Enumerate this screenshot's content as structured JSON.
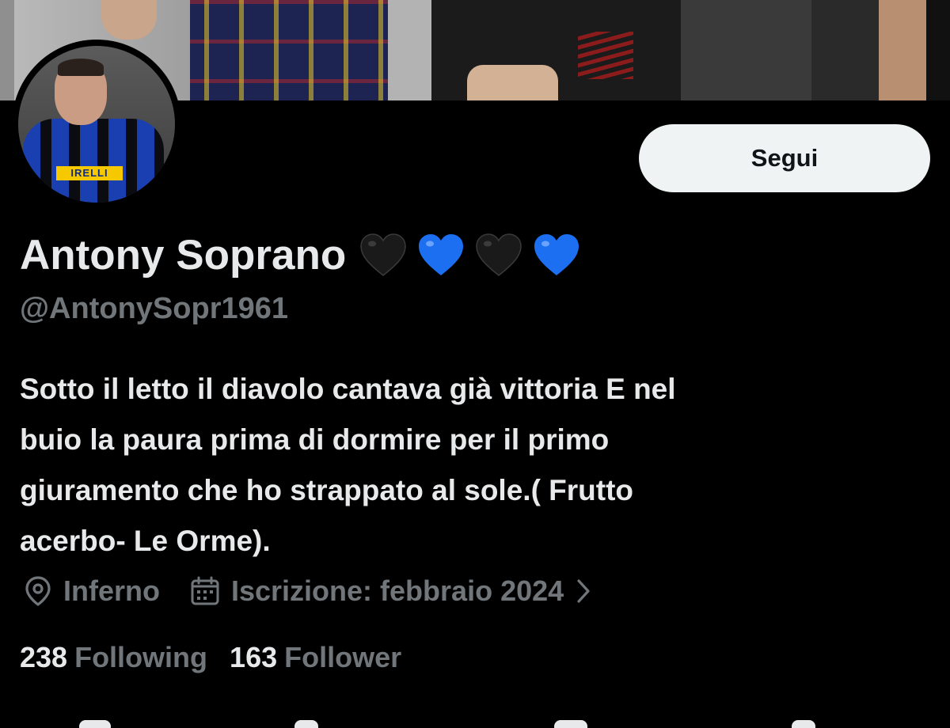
{
  "profile": {
    "display_name": "Antony Soprano",
    "name_emojis": [
      {
        "icon": "black-heart-icon",
        "color": "#1a1a1a"
      },
      {
        "icon": "blue-heart-icon",
        "color": "#1d6ff2"
      },
      {
        "icon": "black-heart-icon",
        "color": "#1a1a1a"
      },
      {
        "icon": "blue-heart-icon",
        "color": "#1d6ff2"
      }
    ],
    "handle": "@AntonySopr1961",
    "bio_lines": [
      "Sotto il letto il diavolo cantava già vittoria E nel",
      "buio la paura prima di dormire per il primo",
      "giuramento che ho strappato al sole.( Frutto",
      "acerbo- Le Orme)."
    ],
    "location": "Inferno",
    "joined": "Iscrizione: febbraio 2024",
    "following_count": "238",
    "following_label": "Following",
    "followers_count": "163",
    "followers_label": "Follower"
  },
  "actions": {
    "follow_label": "Segui"
  },
  "avatar": {
    "jersey_sponsor": "IRELLI"
  },
  "colors": {
    "background": "#000000",
    "primary_text": "#e7e9ea",
    "secondary_text": "#71767b",
    "button_bg": "#eff3f4",
    "button_text": "#0f1419"
  }
}
